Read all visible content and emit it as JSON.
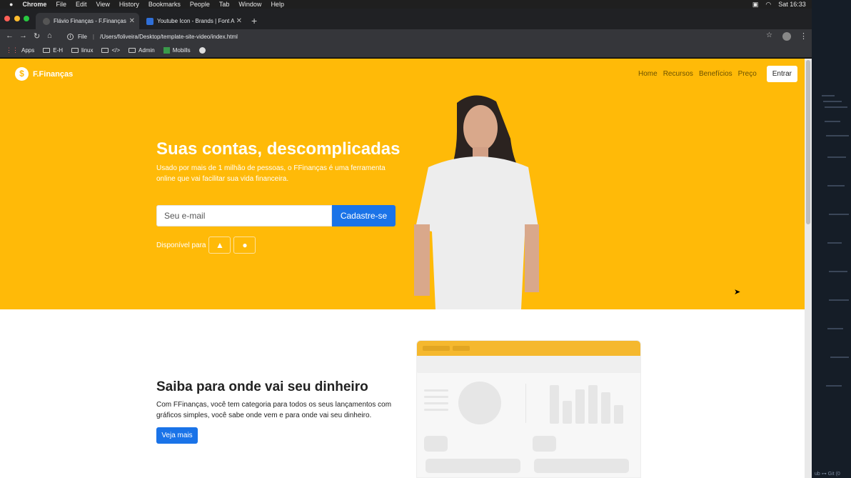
{
  "menubar": {
    "app": "Chrome",
    "items": [
      "File",
      "Edit",
      "View",
      "History",
      "Bookmarks",
      "People",
      "Tab",
      "Window",
      "Help"
    ],
    "clock": "Sat 16:33"
  },
  "tabs": [
    {
      "title": "Flávio Finanças - F.Finanças"
    },
    {
      "title": "Youtube Icon - Brands | Font A"
    }
  ],
  "toolbar": {
    "file_label": "File",
    "url": "/Users/foliveira/Desktop/template-site-video/index.html"
  },
  "bookmarks": [
    "Apps",
    "E-H",
    "linux",
    "</>",
    "Admin",
    "Mobills"
  ],
  "site": {
    "logo": "F.Finanças",
    "nav": [
      "Home",
      "Recursos",
      "Benefícios",
      "Preço"
    ],
    "login": "Entrar",
    "headline": "Suas contas, descomplicadas",
    "lead": "Usado por mais de 1 milhão de pessoas, o FFinanças é uma ferramenta online que vai facilitar sua vida financeira.",
    "email_placeholder": "Seu e-mail",
    "signup": "Cadastre-se",
    "available": "Disponível para",
    "section2_title": "Saiba para onde vai seu dinheiro",
    "section2_text": "Com FFinanças, você tem categoria para todos os seus lançamentos com gráficos simples, você sabe onde vem e para onde vai seu dinheiro.",
    "more": "Veja mais"
  },
  "editor": {
    "footer": "ub  ⊶ Git (0"
  },
  "colors": {
    "brand": "#ffba08",
    "primary": "#1a73e8"
  }
}
